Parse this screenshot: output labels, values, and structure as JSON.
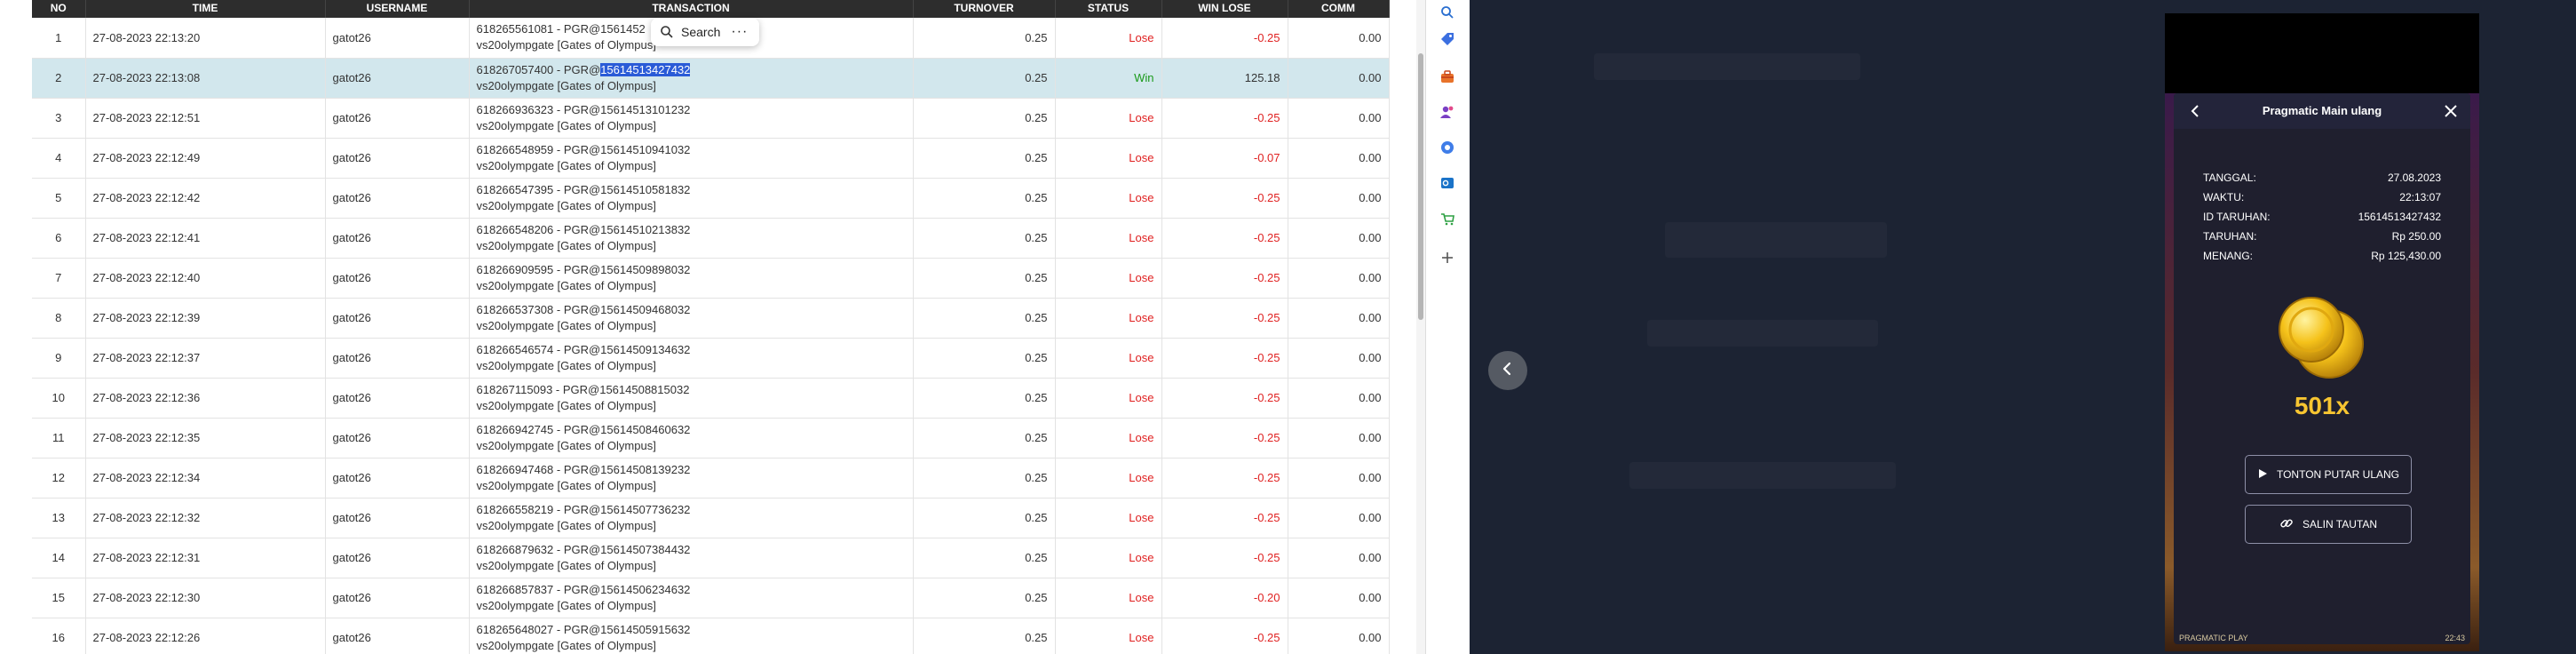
{
  "table": {
    "headers": [
      "NO",
      "TIME",
      "USERNAME",
      "TRANSACTION",
      "TURNOVER",
      "STATUS",
      "WIN LOSE",
      "COMM"
    ],
    "rows": [
      {
        "no": "1",
        "time": "27-08-2023 22:13:20",
        "user": "gatot26",
        "trx_pre": "618265561081 - PGR@1561452",
        "trx_hl": "",
        "trx_post": "",
        "trx_line2": "vs20olympgate [Gates of Olympus]",
        "turnover": "0.25",
        "status": "Lose",
        "winlose": "-0.25",
        "comm": "0.00"
      },
      {
        "no": "2",
        "time": "27-08-2023 22:13:08",
        "user": "gatot26",
        "trx_pre": "618267057400 - PGR@",
        "trx_hl": "15614513427432",
        "trx_post": "",
        "trx_line2": "vs20olympgate [Gates of Olympus]",
        "turnover": "0.25",
        "status": "Win",
        "winlose": "125.18",
        "comm": "0.00"
      },
      {
        "no": "3",
        "time": "27-08-2023 22:12:51",
        "user": "gatot26",
        "trx_pre": "618266936323 - PGR@15614513101232",
        "trx_hl": "",
        "trx_post": "",
        "trx_line2": "vs20olympgate [Gates of Olympus]",
        "turnover": "0.25",
        "status": "Lose",
        "winlose": "-0.25",
        "comm": "0.00"
      },
      {
        "no": "4",
        "time": "27-08-2023 22:12:49",
        "user": "gatot26",
        "trx_pre": "618266548959 - PGR@15614510941032",
        "trx_hl": "",
        "trx_post": "",
        "trx_line2": "vs20olympgate [Gates of Olympus]",
        "turnover": "0.25",
        "status": "Lose",
        "winlose": "-0.07",
        "comm": "0.00"
      },
      {
        "no": "5",
        "time": "27-08-2023 22:12:42",
        "user": "gatot26",
        "trx_pre": "618266547395 - PGR@15614510581832",
        "trx_hl": "",
        "trx_post": "",
        "trx_line2": "vs20olympgate [Gates of Olympus]",
        "turnover": "0.25",
        "status": "Lose",
        "winlose": "-0.25",
        "comm": "0.00"
      },
      {
        "no": "6",
        "time": "27-08-2023 22:12:41",
        "user": "gatot26",
        "trx_pre": "618266548206 - PGR@15614510213832",
        "trx_hl": "",
        "trx_post": "",
        "trx_line2": "vs20olympgate [Gates of Olympus]",
        "turnover": "0.25",
        "status": "Lose",
        "winlose": "-0.25",
        "comm": "0.00"
      },
      {
        "no": "7",
        "time": "27-08-2023 22:12:40",
        "user": "gatot26",
        "trx_pre": "618266909595 - PGR@15614509898032",
        "trx_hl": "",
        "trx_post": "",
        "trx_line2": "vs20olympgate [Gates of Olympus]",
        "turnover": "0.25",
        "status": "Lose",
        "winlose": "-0.25",
        "comm": "0.00"
      },
      {
        "no": "8",
        "time": "27-08-2023 22:12:39",
        "user": "gatot26",
        "trx_pre": "618266537308 - PGR@15614509468032",
        "trx_hl": "",
        "trx_post": "",
        "trx_line2": "vs20olympgate [Gates of Olympus]",
        "turnover": "0.25",
        "status": "Lose",
        "winlose": "-0.25",
        "comm": "0.00"
      },
      {
        "no": "9",
        "time": "27-08-2023 22:12:37",
        "user": "gatot26",
        "trx_pre": "618266546574 - PGR@15614509134632",
        "trx_hl": "",
        "trx_post": "",
        "trx_line2": "vs20olympgate [Gates of Olympus]",
        "turnover": "0.25",
        "status": "Lose",
        "winlose": "-0.25",
        "comm": "0.00"
      },
      {
        "no": "10",
        "time": "27-08-2023 22:12:36",
        "user": "gatot26",
        "trx_pre": "618267115093 - PGR@15614508815032",
        "trx_hl": "",
        "trx_post": "",
        "trx_line2": "vs20olympgate [Gates of Olympus]",
        "turnover": "0.25",
        "status": "Lose",
        "winlose": "-0.25",
        "comm": "0.00"
      },
      {
        "no": "11",
        "time": "27-08-2023 22:12:35",
        "user": "gatot26",
        "trx_pre": "618266942745 - PGR@15614508460632",
        "trx_hl": "",
        "trx_post": "",
        "trx_line2": "vs20olympgate [Gates of Olympus]",
        "turnover": "0.25",
        "status": "Lose",
        "winlose": "-0.25",
        "comm": "0.00"
      },
      {
        "no": "12",
        "time": "27-08-2023 22:12:34",
        "user": "gatot26",
        "trx_pre": "618266947468 - PGR@15614508139232",
        "trx_hl": "",
        "trx_post": "",
        "trx_line2": "vs20olympgate [Gates of Olympus]",
        "turnover": "0.25",
        "status": "Lose",
        "winlose": "-0.25",
        "comm": "0.00"
      },
      {
        "no": "13",
        "time": "27-08-2023 22:12:32",
        "user": "gatot26",
        "trx_pre": "618266558219 - PGR@15614507736232",
        "trx_hl": "",
        "trx_post": "",
        "trx_line2": "vs20olympgate [Gates of Olympus]",
        "turnover": "0.25",
        "status": "Lose",
        "winlose": "-0.25",
        "comm": "0.00"
      },
      {
        "no": "14",
        "time": "27-08-2023 22:12:31",
        "user": "gatot26",
        "trx_pre": "618266879632 - PGR@15614507384432",
        "trx_hl": "",
        "trx_post": "",
        "trx_line2": "vs20olympgate [Gates of Olympus]",
        "turnover": "0.25",
        "status": "Lose",
        "winlose": "-0.25",
        "comm": "0.00"
      },
      {
        "no": "15",
        "time": "27-08-2023 22:12:30",
        "user": "gatot26",
        "trx_pre": "618266857837 - PGR@15614506234632",
        "trx_hl": "",
        "trx_post": "",
        "trx_line2": "vs20olympgate [Gates of Olympus]",
        "turnover": "0.25",
        "status": "Lose",
        "winlose": "-0.20",
        "comm": "0.00"
      },
      {
        "no": "16",
        "time": "27-08-2023 22:12:26",
        "user": "gatot26",
        "trx_pre": "618265648027 - PGR@15614505915632",
        "trx_hl": "",
        "trx_post": "",
        "trx_line2": "vs20olympgate [Gates of Olympus]",
        "turnover": "0.25",
        "status": "Lose",
        "winlose": "-0.25",
        "comm": "0.00"
      }
    ],
    "selected_row": 1
  },
  "popup": {
    "search_label": "Search",
    "more_icon": "more-dots-icon"
  },
  "edge_sidebar": {
    "icons": [
      "search-icon",
      "tag-icon",
      "toolbox-icon",
      "people-icon",
      "settings-globe-icon",
      "outlook-icon",
      "cart-icon",
      "add-icon"
    ]
  },
  "viewer": {
    "prev_icon": "chevron-left-icon"
  },
  "game": {
    "title": "Pragmatic Main ulang",
    "info": [
      {
        "label": "TANGGAL:",
        "value": "27.08.2023"
      },
      {
        "label": "WAKTU:",
        "value": "22:13:07"
      },
      {
        "label": "ID TARUHAN:",
        "value": "15614513427432"
      },
      {
        "label": "TARUHAN:",
        "value": "Rp 250.00"
      },
      {
        "label": "MENANG:",
        "value": "Rp 125,430.00"
      }
    ],
    "multiplier": "501x",
    "replay_label": "TONTON PUTAR ULANG",
    "copy_link_label": "SALIN TAUTAN",
    "footer_brand": "PRAGMATIC PLAY",
    "footer_time": "22:43"
  },
  "colors": {
    "lose": "#e02020",
    "win": "#1a9a1a",
    "selected_row": "#d2e7ed",
    "multiplier": "#f7c531",
    "highlight": "#2a5bd7"
  }
}
